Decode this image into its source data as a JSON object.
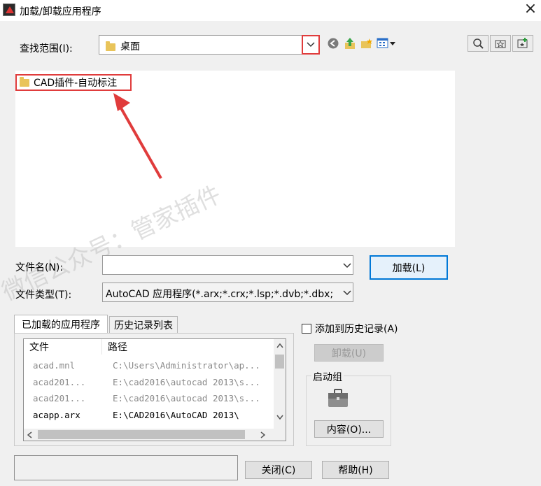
{
  "window": {
    "title": "加载/卸载应用程序",
    "close_glyph": "×"
  },
  "lookin": {
    "label": "查找范围(I):",
    "value": "桌面",
    "dropdown_icon": "chevron-down-icon"
  },
  "file_list": {
    "items": [
      {
        "label": "CAD插件-自动标注",
        "icon": "folder-icon"
      }
    ]
  },
  "watermark": "微信公众号：管家插件",
  "filename": {
    "label": "文件名(N):",
    "value": ""
  },
  "filetype": {
    "label": "文件类型(T):",
    "value": "AutoCAD 应用程序(*.arx;*.crx;*.lsp;*.dvb;*.dbx;"
  },
  "load_button": "加载(L)",
  "tabs": [
    {
      "label": "已加载的应用程序",
      "active": true
    },
    {
      "label": "历史记录列表",
      "active": false
    }
  ],
  "loaded_list": {
    "columns": [
      "文件",
      "路径"
    ],
    "rows": [
      {
        "file": "acad.mnl",
        "path": "C:\\Users\\Administrator\\ap...",
        "active": false
      },
      {
        "file": "acad201...",
        "path": "E:\\cad2016\\autocad 2013\\s...",
        "active": false
      },
      {
        "file": "acad201...",
        "path": "E:\\cad2016\\autocad 2013\\s...",
        "active": false
      },
      {
        "file": "acapp.arx",
        "path": "E:\\CAD2016\\AutoCAD 2013\\",
        "active": true
      }
    ]
  },
  "add_history": {
    "label": "添加到历史记录(A)",
    "checked": false
  },
  "unload_button": "卸载(U)",
  "startup_group": {
    "label": "启动组",
    "icon": "briefcase-icon",
    "contents_button": "内容(O)..."
  },
  "close_button": "关闭(C)",
  "help_button": "帮助(H)",
  "colors": {
    "highlight_red": "#e03c3c",
    "focus_blue": "#0078d7",
    "folder_yellow": "#e9c45a"
  }
}
